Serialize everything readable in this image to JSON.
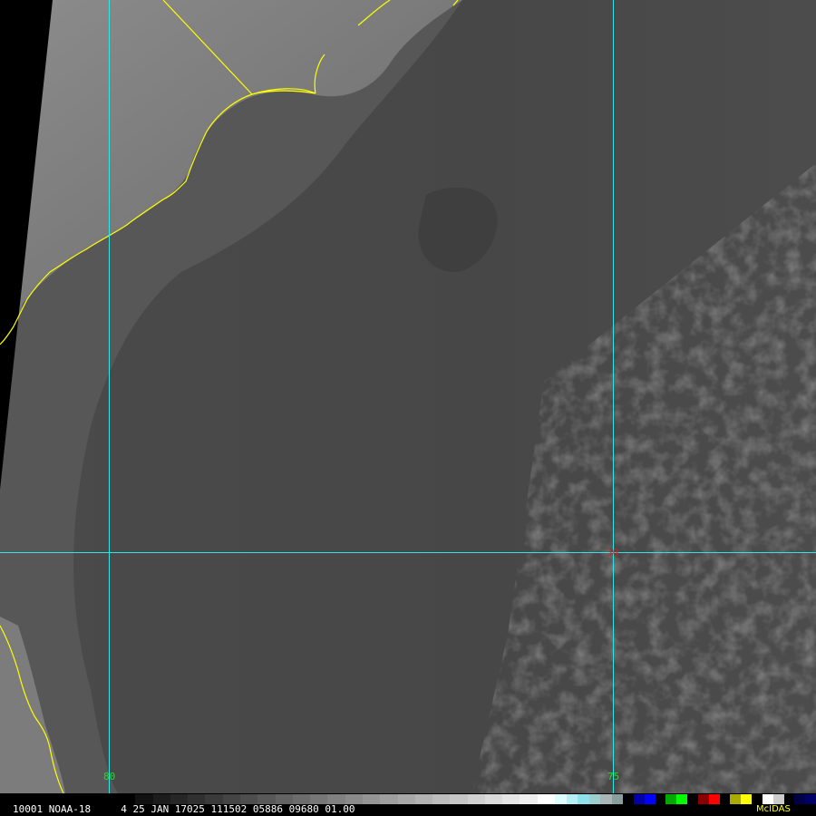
{
  "status": {
    "text": "10001 NOAA-18     4 25 JAN 17025 111502 05886 09680 01.00",
    "mcidas": "McIDAS"
  },
  "grid": {
    "lon_labels": [
      "80",
      "75"
    ],
    "lat_labels": [
      "30"
    ],
    "line_color": "#2ee6e6",
    "lon_label_color": "#22dd22",
    "lat_label_color": "#cc2222"
  },
  "coastline_color": "#ffff00",
  "colorbar": {
    "gray_steps": [
      "#000000",
      "#111111",
      "#1c1c1c",
      "#262626",
      "#303030",
      "#3a3a3a",
      "#444444",
      "#4e4e4e",
      "#585858",
      "#626262",
      "#6c6c6c",
      "#767676",
      "#808080",
      "#8a8a8a",
      "#949494",
      "#9e9e9e",
      "#a8a8a8",
      "#b2b2b2",
      "#bcbcbc",
      "#c6c6c6",
      "#d0d0d0",
      "#dadada",
      "#e4e4e4",
      "#eeeeee",
      "#ffffff"
    ],
    "cyan_steps": [
      "#dffcff",
      "#b6f0f4",
      "#8ee4ea",
      "#9ccfd2",
      "#a8b6b8",
      "#8a9ea0"
    ],
    "color_steps": [
      "#000000",
      "#0000aa",
      "#0000ff",
      "#000000",
      "#00aa00",
      "#00ff00",
      "#000000",
      "#880000",
      "#ff0000",
      "#000000",
      "#aaaa00",
      "#ffff00",
      "#000000",
      "#ffffff",
      "#cccccc",
      "#000000",
      "#000044",
      "#000066"
    ]
  }
}
